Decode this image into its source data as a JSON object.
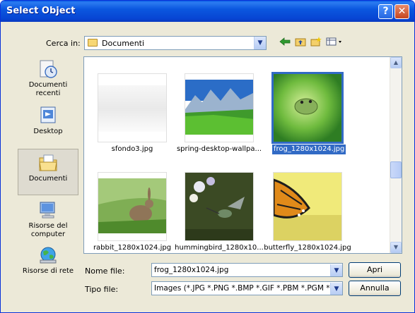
{
  "window": {
    "title": "Select Object",
    "help_glyph": "?",
    "close_glyph": "✕"
  },
  "toolbar": {
    "lookin_label": "Cerca in:",
    "lookin_value": "Documenti"
  },
  "places": [
    {
      "label": "Documenti recenti"
    },
    {
      "label": "Desktop"
    },
    {
      "label": "Documenti"
    },
    {
      "label": "Risorse del computer"
    },
    {
      "label": "Risorse di rete"
    }
  ],
  "files": [
    {
      "name": "sfondo3.jpg"
    },
    {
      "name": "spring-desktop-wallpa..."
    },
    {
      "name": "frog_1280x1024.jpg"
    },
    {
      "name": "rabbit_1280x1024.jpg"
    },
    {
      "name": "hummingbird_1280x10..."
    },
    {
      "name": "butterfly_1280x1024.jpg"
    }
  ],
  "form": {
    "filename_label": "Nome file:",
    "filename_value": "frog_1280x1024.jpg",
    "filetype_label": "Tipo file:",
    "filetype_value": "Images (*.JPG *.PNG *.BMP *.GIF *.PBM *.PGM *.PF",
    "open_label": "Apri",
    "cancel_label": "Annulla"
  },
  "colors": {
    "titlebar": "#0a52dc",
    "selection": "#316ac5",
    "dialog_bg": "#ece9d8"
  }
}
